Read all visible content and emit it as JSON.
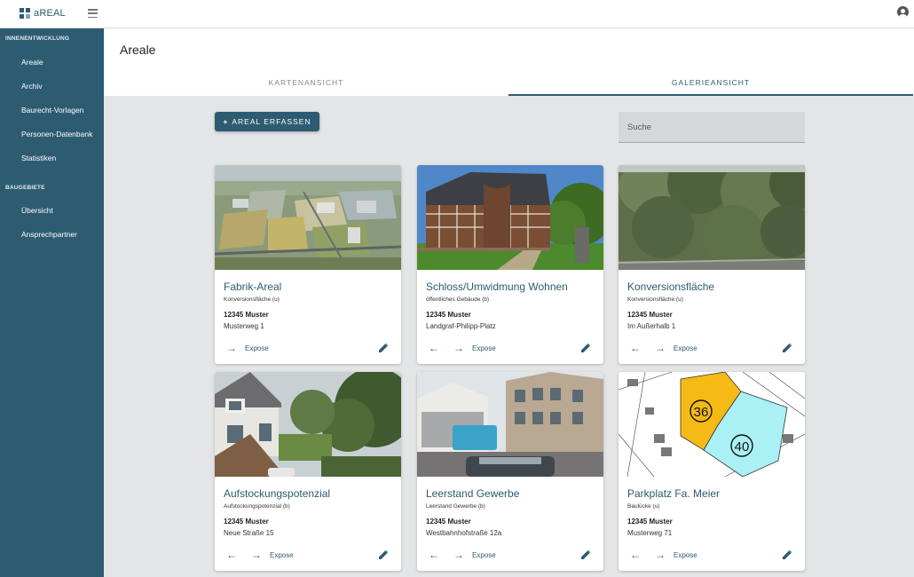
{
  "app": {
    "brand": "aREAL"
  },
  "sidebar": {
    "sections": [
      {
        "label": "INNENENTWICKLUNG",
        "items": [
          "Areale",
          "Archiv",
          "Baurecht-Vorlagen",
          "Personen-Datenbank",
          "Statistiken"
        ]
      },
      {
        "label": "BAUGEBIETE",
        "items": [
          "Übersicht",
          "Ansprechpartner"
        ]
      }
    ]
  },
  "header": {
    "title": "Areale",
    "tabs": [
      {
        "label": "KARTENANSICHT",
        "active": false
      },
      {
        "label": "GALERIEANSICHT",
        "active": true
      }
    ]
  },
  "toolbar": {
    "add_label": "AREAL ERFASSEN",
    "search_placeholder": "Suche"
  },
  "colors": {
    "primary": "#2d5b72",
    "background": "#e4e5e6"
  },
  "cards": [
    {
      "title": "Fabrik-Areal",
      "type": "Konversionsfläche (u)",
      "city": "12345 Muster",
      "street": "Musterweg 1",
      "expose": "Expose",
      "has_prev": false
    },
    {
      "title": "Schloss/Umwidmung Wohnen",
      "type": "öffentliches Gebäude (b)",
      "city": "12345 Muster",
      "street": "Landgraf-Philipp-Platz",
      "expose": "Expose",
      "has_prev": true
    },
    {
      "title": "Konversionsfläche",
      "type": "Konversionsfläche (u)",
      "city": "12345 Muster",
      "street": "Im Außerhalb 1",
      "expose": "Expose",
      "has_prev": true
    },
    {
      "title": "Aufstockungspotenzial",
      "type": "Aufstockungspotenzial (b)",
      "city": "12345 Muster",
      "street": "Neue Straße 15",
      "expose": "Expose",
      "has_prev": true
    },
    {
      "title": "Leerstand Gewerbe",
      "type": "Leerstand Gewerbe (b)",
      "city": "12345 Muster",
      "street": "Westbahnhofstraße 12a",
      "expose": "Expose",
      "has_prev": true
    },
    {
      "title": "Parkplatz Fa. Meier",
      "type": "Baulücke (u)",
      "city": "12345 Muster",
      "street": "Musterweg 71",
      "expose": "Expose",
      "has_prev": true,
      "plot_labels": [
        "36",
        "40"
      ]
    }
  ]
}
